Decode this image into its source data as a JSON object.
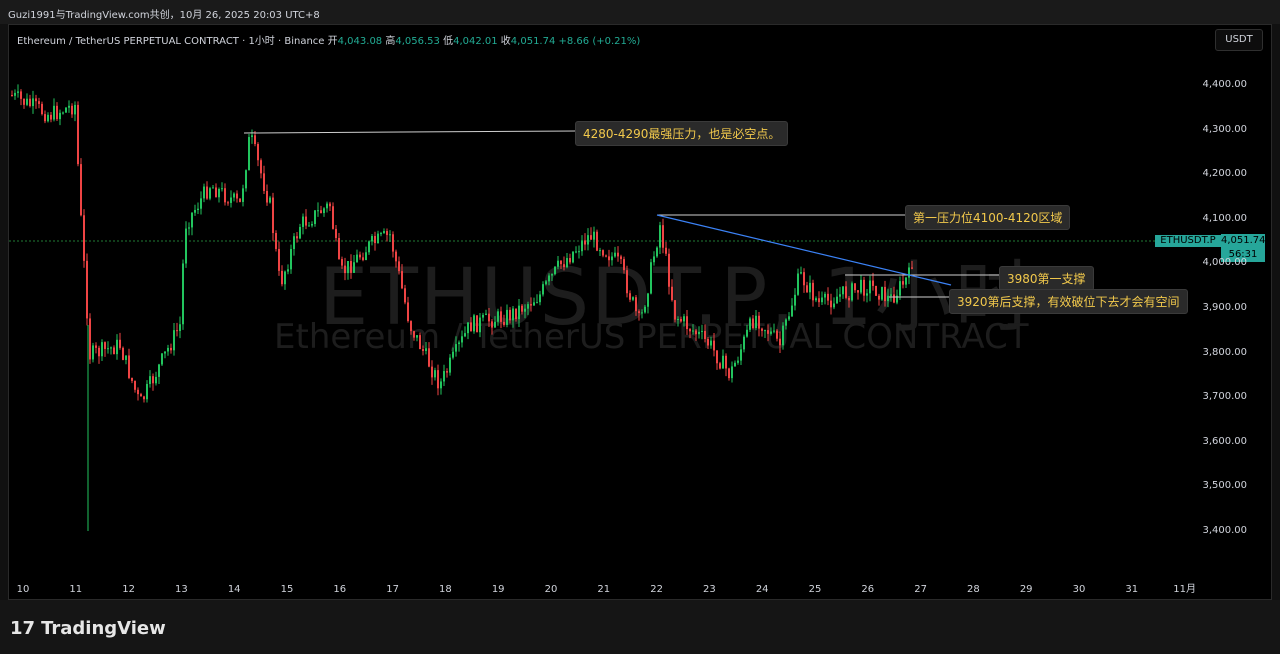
{
  "topbar": {
    "text": "Guzi1991与TradingView.com共创，10月 26, 2025 20:03 UTC+8"
  },
  "legend": {
    "title": "Ethereum / TetherUS PERPETUAL CONTRACT · 1小时 · Binance",
    "open_label": "开",
    "open_value": "4,043.08",
    "high_label": "高",
    "high_value": "4,056.53",
    "low_label": "低",
    "low_value": "4,042.01",
    "close_label": "收",
    "close_value": "4,051.74",
    "change_value": "+8.66 (+0.21%)"
  },
  "currency_button": "USDT",
  "watermark": {
    "symbol": "ETHUSDT.P, 1小时",
    "name": "Ethereum / TetherUS PERPETUAL CONTRACT"
  },
  "annotations": [
    "4280-4290最强压力，也是必空点。",
    "第一压力位4100-4120区域",
    "3980第一支撑",
    "3920第后支撑，有效破位下去才会有空间"
  ],
  "price_tag": {
    "symbol": "ETHUSDT.P",
    "price": "4,051.74",
    "countdown": "56:31"
  },
  "y_axis_labels": [
    "4,400.00",
    "4,300.00",
    "4,200.00",
    "4,100.00",
    "4,000.00",
    "3,900.00",
    "3,800.00",
    "3,700.00",
    "3,600.00",
    "3,500.00",
    "3,400.00"
  ],
  "x_axis_labels": [
    "10",
    "11",
    "12",
    "13",
    "14",
    "15",
    "16",
    "17",
    "18",
    "19",
    "20",
    "21",
    "22",
    "23",
    "24",
    "25",
    "26",
    "27",
    "28",
    "29",
    "30",
    "31",
    "11月"
  ],
  "footer": {
    "brand": "TradingView"
  },
  "colors": {
    "up": "#22c55e",
    "down": "#ef4444",
    "trendline": "#3b82f6",
    "annotation_text": "#f2c94c"
  }
}
